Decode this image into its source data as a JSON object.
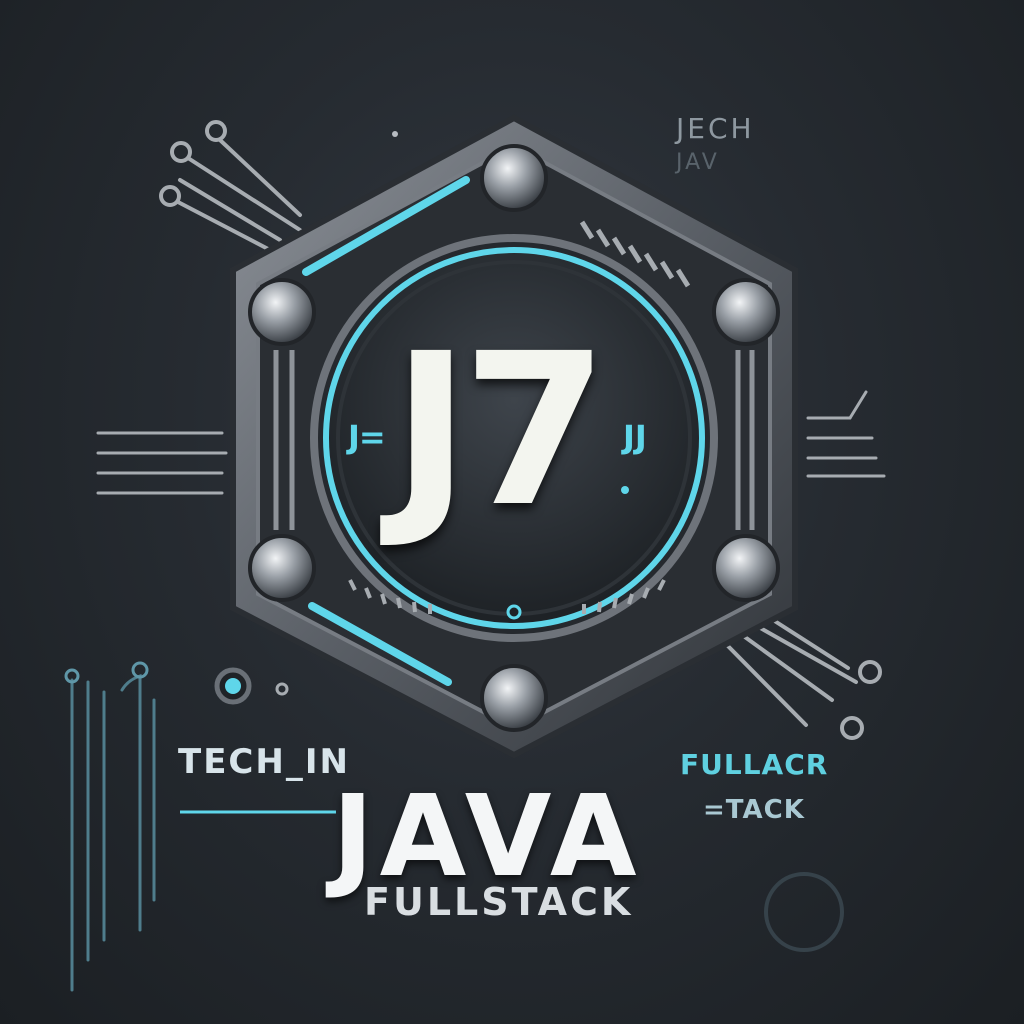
{
  "emblem": {
    "monogram": "J7",
    "left_glyph": "J=",
    "right_glyph": "JJ"
  },
  "labels": {
    "top_right_line1": "JECH",
    "top_right_line2": "JAV",
    "left_tag": "TECH_IN",
    "right_tag_line1": "FULLACR",
    "right_tag_line2": "=TACK",
    "title": "JAVA",
    "subtitle": "FULLSTACK"
  },
  "colors": {
    "background": "#262b31",
    "accent": "#5fd6ea",
    "metal": "#7b8087",
    "text": "#f4f6f7"
  }
}
